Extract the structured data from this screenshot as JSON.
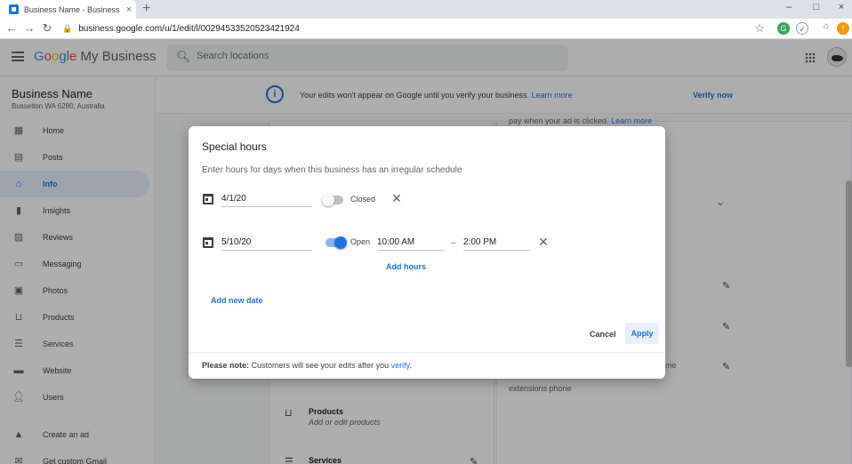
{
  "browser": {
    "tab_title": "Business Name - Business Info",
    "tab_close": "×",
    "new_tab": "+",
    "url": "business.google.com/u/1/edit/l/00294533520523421924",
    "window_controls": [
      "–",
      "□",
      "×"
    ],
    "extension_letters": [
      "G",
      "!"
    ]
  },
  "header": {
    "logo_google": [
      "G",
      "o",
      "o",
      "g",
      "l",
      "e"
    ],
    "logo_rest": " My Business",
    "search_placeholder": "Search locations"
  },
  "sidebar": {
    "business_name": "Business Name",
    "business_address": "Busselton WA 6280, Australia",
    "items": [
      {
        "label": "Home",
        "icon": "dashboard-icon"
      },
      {
        "label": "Posts",
        "icon": "posts-icon"
      },
      {
        "label": "Info",
        "icon": "storefront-icon",
        "active": true
      },
      {
        "label": "Insights",
        "icon": "bar-chart-icon"
      },
      {
        "label": "Reviews",
        "icon": "reviews-icon"
      },
      {
        "label": "Messaging",
        "icon": "message-icon"
      },
      {
        "label": "Photos",
        "icon": "photos-icon"
      },
      {
        "label": "Products",
        "icon": "basket-icon"
      },
      {
        "label": "Services",
        "icon": "list-icon"
      },
      {
        "label": "Website",
        "icon": "website-icon"
      },
      {
        "label": "Users",
        "icon": "add-user-icon"
      },
      {
        "label": "Create an ad",
        "icon": "ads-icon"
      },
      {
        "label": "Get custom Gmail",
        "icon": "mail-icon"
      }
    ]
  },
  "banner": {
    "text": "Your edits won't appear on Google until you verify your business.",
    "learn_more": "Learn more",
    "verify_now": "Verify now"
  },
  "background": {
    "ad_text": "pay when your ad is clicked.",
    "ad_link": "Learn more",
    "extensions_phone": "extensions phone",
    "products_title": "Products",
    "products_sub": "Add or edit products",
    "services_title": "Services",
    "fragment_me": "me"
  },
  "dialog": {
    "title": "Special hours",
    "subtitle": "Enter hours for days when this business has an irregular schedule",
    "rows": [
      {
        "date": "4/1/20",
        "open": false,
        "status_label": "Closed"
      },
      {
        "date": "5/10/20",
        "open": true,
        "status_label": "Open",
        "open_time": "10:00 AM",
        "close_time": "2:00 PM"
      }
    ],
    "time_separator": "–",
    "add_hours": "Add hours",
    "add_new_date": "Add new date",
    "cancel": "Cancel",
    "apply": "Apply",
    "note_bold": "Please note:",
    "note_text": " Customers will see your edits after you ",
    "note_link": "verify",
    "note_end": "."
  }
}
